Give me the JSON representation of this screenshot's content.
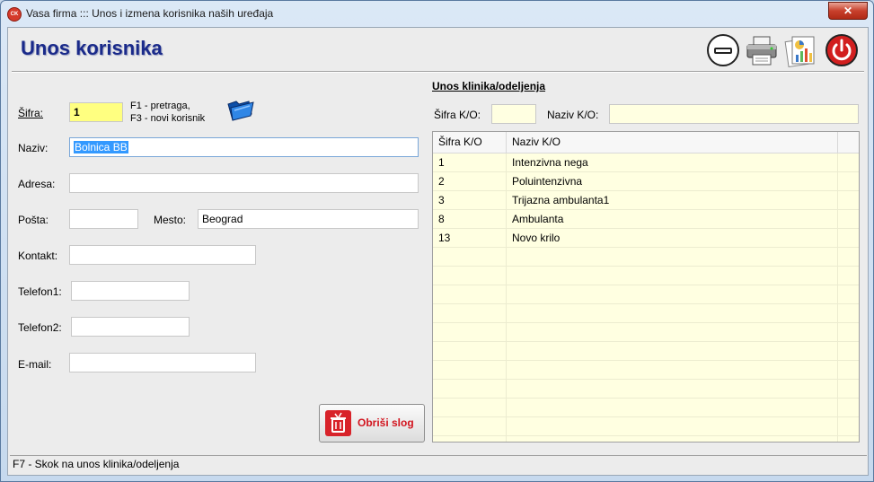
{
  "window": {
    "icon_text": "CK",
    "title": "Vasa firma ::: Unos i izmena korisnika naših uređaja",
    "close_glyph": "✕"
  },
  "page": {
    "title": "Unos korisnika"
  },
  "toolbar": {
    "icons": [
      "minimize-icon",
      "printer-icon",
      "report-chart-icon",
      "power-icon"
    ]
  },
  "form": {
    "sifra": {
      "label": "Šifra:",
      "value": "1"
    },
    "hint_line1": "F1 - pretraga,",
    "hint_line2": "F3 - novi korisnik",
    "naziv": {
      "label": "Naziv:",
      "value": "Bolnica BB"
    },
    "adresa": {
      "label": "Adresa:",
      "value": ""
    },
    "posta": {
      "label": "Pošta:",
      "value": ""
    },
    "mesto": {
      "label": "Mesto:",
      "value": "Beograd"
    },
    "kontakt": {
      "label": "Kontakt:",
      "value": ""
    },
    "telefon1": {
      "label": "Telefon1:",
      "value": ""
    },
    "telefon2": {
      "label": "Telefon2:",
      "value": ""
    },
    "email": {
      "label": "E-mail:",
      "value": ""
    }
  },
  "delete_button": {
    "label": "Obriši slog"
  },
  "klinike": {
    "title": "Unos klinika/odeljenja",
    "sifra_label": "Šifra K/O:",
    "sifra_value": "",
    "naziv_label": "Naziv K/O:",
    "naziv_value": "",
    "columns": [
      "Šifra K/O",
      "Naziv K/O"
    ],
    "rows": [
      {
        "sifra": "1",
        "naziv": "Intenzivna nega"
      },
      {
        "sifra": "2",
        "naziv": "Poluintenzivna"
      },
      {
        "sifra": "3",
        "naziv": "Trijazna ambulanta1"
      },
      {
        "sifra": "8",
        "naziv": "Ambulanta"
      },
      {
        "sifra": "13",
        "naziv": "Novo krilo"
      }
    ]
  },
  "status_bar": {
    "text": "F7 - Skok na unos klinika/odeljenja"
  },
  "colors": {
    "title": "#1a2a8a",
    "sifra_field": "#ffff80",
    "grid_bg": "#ffffe1",
    "delete_label": "#d2141e",
    "selection": "#3399ff"
  }
}
